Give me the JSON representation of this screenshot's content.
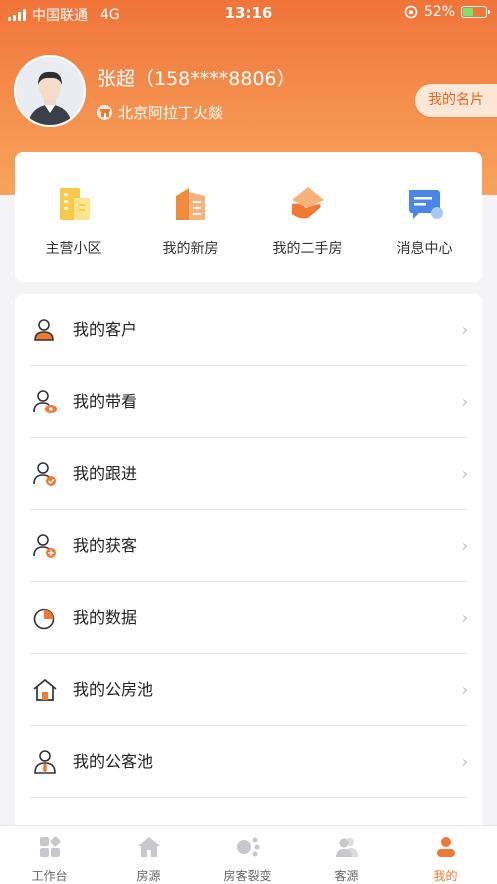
{
  "status_bar": {
    "carrier": "中国联通",
    "network": "4G",
    "time": "13:16",
    "battery_percent": "52%",
    "battery_level": 0.52
  },
  "profile": {
    "name": "张超（158****8806）",
    "location": "北京阿拉丁火燚",
    "card_button": "我的名片"
  },
  "quick_actions": [
    {
      "label": "主营小区",
      "icon": "building-icon"
    },
    {
      "label": "我的新房",
      "icon": "new-house-icon"
    },
    {
      "label": "我的二手房",
      "icon": "second-hand-house-icon"
    },
    {
      "label": "消息中心",
      "icon": "message-icon"
    }
  ],
  "menu": [
    {
      "label": "我的客户",
      "icon": "customer-icon"
    },
    {
      "label": "我的带看",
      "icon": "viewing-icon"
    },
    {
      "label": "我的跟进",
      "icon": "follow-up-icon"
    },
    {
      "label": "我的获客",
      "icon": "acquire-customer-icon"
    },
    {
      "label": "我的数据",
      "icon": "pie-chart-icon"
    },
    {
      "label": "我的公房池",
      "icon": "public-house-pool-icon"
    },
    {
      "label": "我的公客池",
      "icon": "public-customer-pool-icon"
    }
  ],
  "chevron": "›",
  "tabs": [
    {
      "label": "工作台",
      "icon": "workbench-icon",
      "active": false
    },
    {
      "label": "房源",
      "icon": "house-icon",
      "active": false
    },
    {
      "label": "房客裂变",
      "icon": "share-icon",
      "active": false
    },
    {
      "label": "客源",
      "icon": "clients-icon",
      "active": false
    },
    {
      "label": "我的",
      "icon": "me-icon",
      "active": true
    }
  ],
  "colors": {
    "accent": "#f07a34",
    "header_top": "#f0743a",
    "header_bottom": "#f7a35c",
    "tab_inactive": "#c8c8cc"
  }
}
